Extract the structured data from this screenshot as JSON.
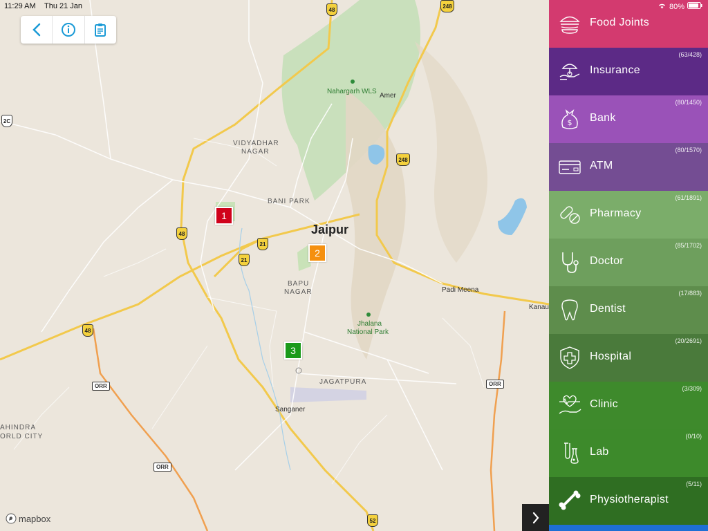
{
  "status_bar": {
    "time": "11:29 AM",
    "date": "Thu 21 Jan",
    "battery": "80%"
  },
  "toolbar": {
    "back_icon": "chevron-left-icon",
    "info_icon": "info-icon",
    "report_icon": "clipboard-icon"
  },
  "map": {
    "city": "Jaipur",
    "labels": {
      "vidyadhar_1": "VIDYADHAR",
      "vidyadhar_2": "NAGAR",
      "bani_park": "BANI PARK",
      "bapu_1": "BAPU",
      "bapu_2": "NAGAR",
      "jagatpura": "JAGATPURA",
      "sanganer": "Sanganer",
      "amer": "Amer",
      "nahargarh": "Nahargarh WLS",
      "jhalana_1": "Jhalana",
      "jhalana_2": "National Park",
      "padi_meena": "Padi Meena",
      "kanau": "Kanau",
      "mahindra_1": "AHINDRA",
      "mahindra_2": "ORLD CITY"
    },
    "markers": [
      {
        "num": "1",
        "color": "#d0021b"
      },
      {
        "num": "2",
        "color": "#f5900f"
      },
      {
        "num": "3",
        "color": "#1a9a1a"
      }
    ],
    "shields": {
      "s48a": "48",
      "s248a": "248",
      "s2c": "2C",
      "s248b": "248",
      "s48b": "48",
      "s21a": "21",
      "s21b": "21",
      "s48c": "48",
      "s52": "52"
    },
    "orr": "ORR",
    "attribution": "mapbox"
  },
  "categories": [
    {
      "name": "Food Joints",
      "count": "",
      "color": "#d33a6f",
      "icon": "burger-icon"
    },
    {
      "name": "Insurance",
      "count": "(63/428)",
      "color": "#5c2a86",
      "icon": "insurance-icon"
    },
    {
      "name": "Bank",
      "count": "(80/1450)",
      "color": "#9a52b8",
      "icon": "money-bag-icon"
    },
    {
      "name": "ATM",
      "count": "(80/1570)",
      "color": "#744d93",
      "icon": "card-icon"
    },
    {
      "name": "Pharmacy",
      "count": "(61/1891)",
      "color": "#7bad6a",
      "icon": "pill-icon"
    },
    {
      "name": "Doctor",
      "count": "(85/1702)",
      "color": "#6e9f5d",
      "icon": "stethoscope-icon"
    },
    {
      "name": "Dentist",
      "count": "(17/883)",
      "color": "#5e8d4c",
      "icon": "tooth-icon"
    },
    {
      "name": "Hospital",
      "count": "(20/2691)",
      "color": "#4a7a3b",
      "icon": "hospital-shield-icon"
    },
    {
      "name": "Clinic",
      "count": "(3/309)",
      "color": "#3e8a2c",
      "icon": "heart-hand-icon"
    },
    {
      "name": "Lab",
      "count": "(0/10)",
      "color": "#3d8a2b",
      "icon": "flask-icon"
    },
    {
      "name": "Physiotherapist",
      "count": "(5/11)",
      "color": "#2f6e22",
      "icon": "bone-icon"
    }
  ]
}
